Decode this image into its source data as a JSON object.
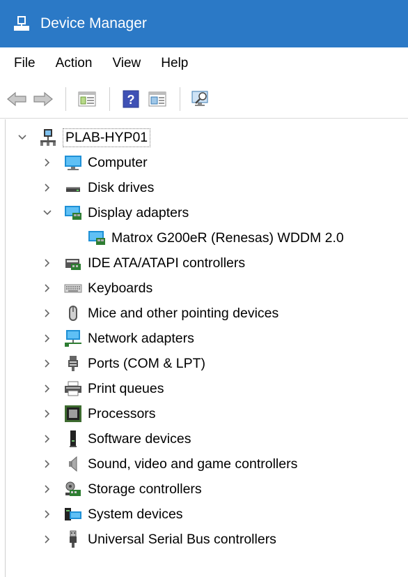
{
  "window": {
    "title": "Device Manager"
  },
  "menu": [
    "File",
    "Action",
    "View",
    "Help"
  ],
  "toolbar": {
    "buttons": [
      "back",
      "forward",
      "show-hide-console-tree",
      "help",
      "properties",
      "scan-for-hardware-changes"
    ]
  },
  "tree": {
    "root": {
      "label": "PLAB-HYP01",
      "expanded": true
    },
    "categories": [
      {
        "label": "Computer",
        "icon": "computer-icon",
        "expanded": false
      },
      {
        "label": "Disk drives",
        "icon": "disk-drive-icon",
        "expanded": false
      },
      {
        "label": "Display adapters",
        "icon": "display-adapter-icon",
        "expanded": true,
        "children": [
          {
            "label": "Matrox G200eR (Renesas) WDDM 2.0",
            "icon": "display-adapter-icon"
          }
        ]
      },
      {
        "label": "IDE ATA/ATAPI controllers",
        "icon": "ide-controller-icon",
        "expanded": false
      },
      {
        "label": "Keyboards",
        "icon": "keyboard-icon",
        "expanded": false
      },
      {
        "label": "Mice and other pointing devices",
        "icon": "mouse-icon",
        "expanded": false
      },
      {
        "label": "Network adapters",
        "icon": "network-adapter-icon",
        "expanded": false
      },
      {
        "label": "Ports (COM & LPT)",
        "icon": "port-icon",
        "expanded": false
      },
      {
        "label": "Print queues",
        "icon": "printer-icon",
        "expanded": false
      },
      {
        "label": "Processors",
        "icon": "processor-icon",
        "expanded": false
      },
      {
        "label": "Software devices",
        "icon": "software-device-icon",
        "expanded": false
      },
      {
        "label": "Sound, video and game controllers",
        "icon": "speaker-icon",
        "expanded": false
      },
      {
        "label": "Storage controllers",
        "icon": "storage-controller-icon",
        "expanded": false
      },
      {
        "label": "System devices",
        "icon": "system-device-icon",
        "expanded": false
      },
      {
        "label": "Universal Serial Bus controllers",
        "icon": "usb-icon",
        "expanded": false
      }
    ]
  },
  "colors": {
    "titlebar": "#2b79c6",
    "title_text": "#ffffff"
  }
}
